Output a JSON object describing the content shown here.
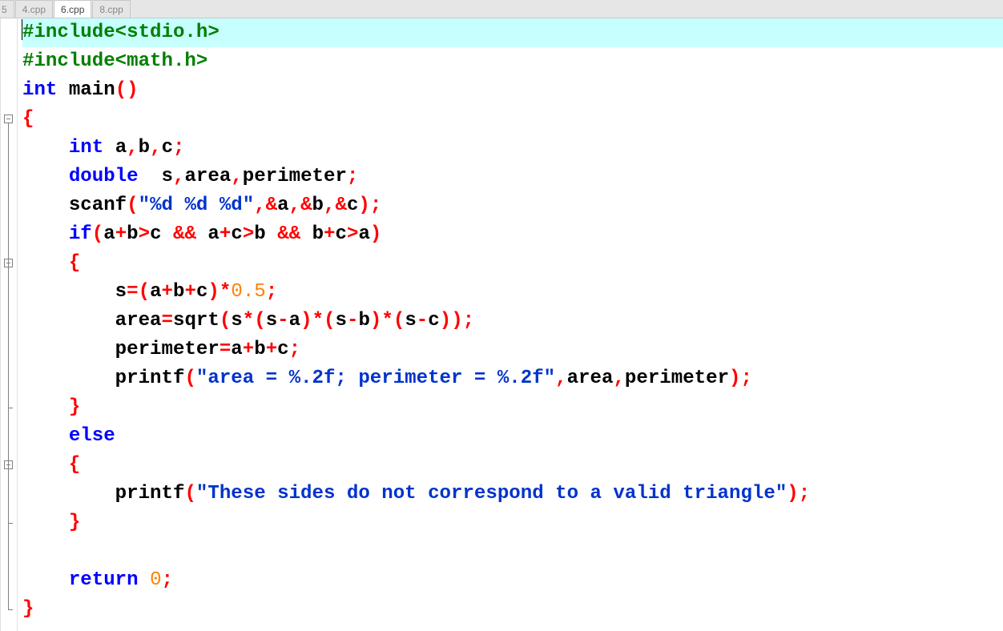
{
  "tabs": {
    "partial": "5",
    "t1": "4.cpp",
    "t2": "6.cpp",
    "t3": "8.cpp",
    "active_index": 2
  },
  "code": {
    "lines": [
      {
        "kind": "preproc",
        "text": "#include<stdio.h>",
        "current": true
      },
      {
        "kind": "preproc",
        "text": "#include<math.h>"
      },
      {
        "kind": "main_sig",
        "kw_int": "int",
        "ident": " main",
        "paren_open": "(",
        "paren_close": ")"
      },
      {
        "kind": "brace_open",
        "text": "{"
      },
      {
        "kind": "decl",
        "indent": "    ",
        "kw": "int",
        "rest_tokens": [
          {
            "t": "plain",
            "v": " a"
          },
          {
            "t": "comma",
            "v": ","
          },
          {
            "t": "plain",
            "v": "b"
          },
          {
            "t": "comma",
            "v": ","
          },
          {
            "t": "plain",
            "v": "c"
          },
          {
            "t": "semi",
            "v": ";"
          }
        ]
      },
      {
        "kind": "decl",
        "indent": "    ",
        "kw": "double",
        "rest_tokens": [
          {
            "t": "plain",
            "v": "  s"
          },
          {
            "t": "comma",
            "v": ","
          },
          {
            "t": "plain",
            "v": "area"
          },
          {
            "t": "comma",
            "v": ","
          },
          {
            "t": "plain",
            "v": "perimeter"
          },
          {
            "t": "semi",
            "v": ";"
          }
        ]
      },
      {
        "kind": "call",
        "indent": "    ",
        "tokens": [
          {
            "t": "func",
            "v": "scanf"
          },
          {
            "t": "paren",
            "v": "("
          },
          {
            "t": "string",
            "v": "\"%d %d %d\""
          },
          {
            "t": "comma",
            "v": ","
          },
          {
            "t": "op",
            "v": "&"
          },
          {
            "t": "plain",
            "v": "a"
          },
          {
            "t": "comma",
            "v": ","
          },
          {
            "t": "op",
            "v": "&"
          },
          {
            "t": "plain",
            "v": "b"
          },
          {
            "t": "comma",
            "v": ","
          },
          {
            "t": "op",
            "v": "&"
          },
          {
            "t": "plain",
            "v": "c"
          },
          {
            "t": "paren",
            "v": ")"
          },
          {
            "t": "semi",
            "v": ";"
          }
        ]
      },
      {
        "kind": "call",
        "indent": "    ",
        "tokens": [
          {
            "t": "keyword",
            "v": "if"
          },
          {
            "t": "paren",
            "v": "("
          },
          {
            "t": "plain",
            "v": "a"
          },
          {
            "t": "op",
            "v": "+"
          },
          {
            "t": "plain",
            "v": "b"
          },
          {
            "t": "op",
            "v": ">"
          },
          {
            "t": "plain",
            "v": "c "
          },
          {
            "t": "op",
            "v": "&&"
          },
          {
            "t": "plain",
            "v": " a"
          },
          {
            "t": "op",
            "v": "+"
          },
          {
            "t": "plain",
            "v": "c"
          },
          {
            "t": "op",
            "v": ">"
          },
          {
            "t": "plain",
            "v": "b "
          },
          {
            "t": "op",
            "v": "&&"
          },
          {
            "t": "plain",
            "v": " b"
          },
          {
            "t": "op",
            "v": "+"
          },
          {
            "t": "plain",
            "v": "c"
          },
          {
            "t": "op",
            "v": ">"
          },
          {
            "t": "plain",
            "v": "a"
          },
          {
            "t": "paren",
            "v": ")"
          }
        ]
      },
      {
        "kind": "brace_open_inner",
        "indent": "    ",
        "text": "{"
      },
      {
        "kind": "call",
        "indent": "        ",
        "tokens": [
          {
            "t": "plain",
            "v": "s"
          },
          {
            "t": "op",
            "v": "="
          },
          {
            "t": "paren",
            "v": "("
          },
          {
            "t": "plain",
            "v": "a"
          },
          {
            "t": "op",
            "v": "+"
          },
          {
            "t": "plain",
            "v": "b"
          },
          {
            "t": "op",
            "v": "+"
          },
          {
            "t": "plain",
            "v": "c"
          },
          {
            "t": "paren",
            "v": ")"
          },
          {
            "t": "op",
            "v": "*"
          },
          {
            "t": "number",
            "v": "0.5"
          },
          {
            "t": "semi",
            "v": ";"
          }
        ]
      },
      {
        "kind": "call",
        "indent": "        ",
        "tokens": [
          {
            "t": "plain",
            "v": "area"
          },
          {
            "t": "op",
            "v": "="
          },
          {
            "t": "func",
            "v": "sqrt"
          },
          {
            "t": "paren",
            "v": "("
          },
          {
            "t": "plain",
            "v": "s"
          },
          {
            "t": "op",
            "v": "*"
          },
          {
            "t": "paren",
            "v": "("
          },
          {
            "t": "plain",
            "v": "s"
          },
          {
            "t": "op",
            "v": "-"
          },
          {
            "t": "plain",
            "v": "a"
          },
          {
            "t": "paren",
            "v": ")"
          },
          {
            "t": "op",
            "v": "*"
          },
          {
            "t": "paren",
            "v": "("
          },
          {
            "t": "plain",
            "v": "s"
          },
          {
            "t": "op",
            "v": "-"
          },
          {
            "t": "plain",
            "v": "b"
          },
          {
            "t": "paren",
            "v": ")"
          },
          {
            "t": "op",
            "v": "*"
          },
          {
            "t": "paren",
            "v": "("
          },
          {
            "t": "plain",
            "v": "s"
          },
          {
            "t": "op",
            "v": "-"
          },
          {
            "t": "plain",
            "v": "c"
          },
          {
            "t": "paren",
            "v": "))"
          },
          {
            "t": "semi",
            "v": ";"
          }
        ]
      },
      {
        "kind": "call",
        "indent": "        ",
        "tokens": [
          {
            "t": "plain",
            "v": "perimeter"
          },
          {
            "t": "op",
            "v": "="
          },
          {
            "t": "plain",
            "v": "a"
          },
          {
            "t": "op",
            "v": "+"
          },
          {
            "t": "plain",
            "v": "b"
          },
          {
            "t": "op",
            "v": "+"
          },
          {
            "t": "plain",
            "v": "c"
          },
          {
            "t": "semi",
            "v": ";"
          }
        ]
      },
      {
        "kind": "call",
        "indent": "        ",
        "tokens": [
          {
            "t": "func",
            "v": "printf"
          },
          {
            "t": "paren",
            "v": "("
          },
          {
            "t": "string",
            "v": "\"area = %.2f; perimeter = %.2f\""
          },
          {
            "t": "comma",
            "v": ","
          },
          {
            "t": "plain",
            "v": "area"
          },
          {
            "t": "comma",
            "v": ","
          },
          {
            "t": "plain",
            "v": "perimeter"
          },
          {
            "t": "paren",
            "v": ")"
          },
          {
            "t": "semi",
            "v": ";"
          }
        ]
      },
      {
        "kind": "brace_close_inner",
        "indent": "    ",
        "text": "}"
      },
      {
        "kind": "call",
        "indent": "    ",
        "tokens": [
          {
            "t": "keyword",
            "v": "else"
          }
        ]
      },
      {
        "kind": "brace_open_inner",
        "indent": "    ",
        "text": "{"
      },
      {
        "kind": "call",
        "indent": "        ",
        "tokens": [
          {
            "t": "func",
            "v": "printf"
          },
          {
            "t": "paren",
            "v": "("
          },
          {
            "t": "string",
            "v": "\"These sides do not correspond to a valid triangle\""
          },
          {
            "t": "paren",
            "v": ")"
          },
          {
            "t": "semi",
            "v": ";"
          }
        ]
      },
      {
        "kind": "brace_close_inner",
        "indent": "    ",
        "text": "}"
      },
      {
        "kind": "blank",
        "indent": "    ",
        "text": ""
      },
      {
        "kind": "call",
        "indent": "    ",
        "tokens": [
          {
            "t": "keyword",
            "v": "return"
          },
          {
            "t": "plain",
            "v": " "
          },
          {
            "t": "number",
            "v": "0"
          },
          {
            "t": "semi",
            "v": ";"
          }
        ]
      },
      {
        "kind": "brace_close",
        "text": "}"
      }
    ]
  },
  "fold_markers": {
    "line_height": 36,
    "boxes": [
      3,
      8,
      15
    ],
    "vline_segments": [
      {
        "from": 3,
        "to": 20
      },
      {
        "from": 8,
        "to": 13
      },
      {
        "from": 15,
        "to": 17
      }
    ],
    "corners": [
      20,
      13,
      17
    ]
  }
}
